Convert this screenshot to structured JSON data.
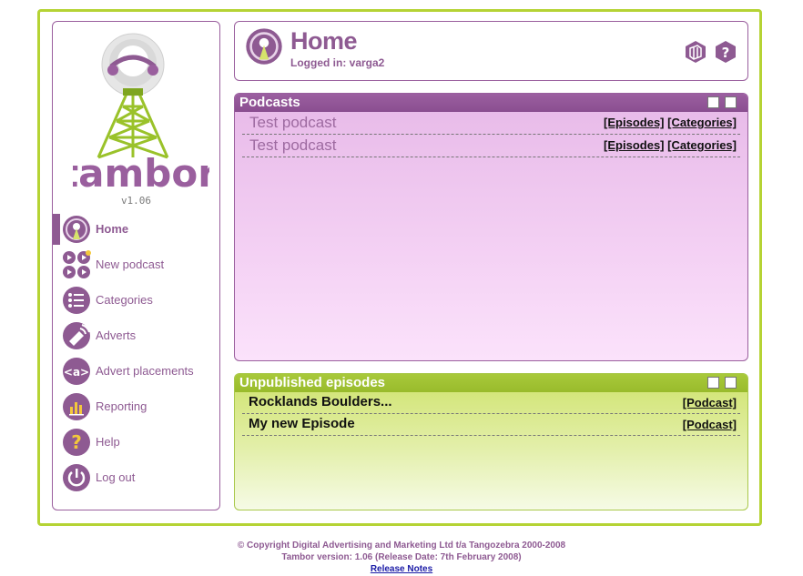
{
  "app": {
    "name": "tambor",
    "version": "v1.06"
  },
  "sidebar": {
    "items": [
      {
        "label": "Home",
        "icon": "broadcast-icon",
        "active": true
      },
      {
        "label": "New podcast",
        "icon": "new-podcast-icon",
        "active": false
      },
      {
        "label": "Categories",
        "icon": "list-icon",
        "active": false
      },
      {
        "label": "Adverts",
        "icon": "megaphone-icon",
        "active": false
      },
      {
        "label": "Advert placements",
        "icon": "tag-icon",
        "active": false
      },
      {
        "label": "Reporting",
        "icon": "bar-chart-icon",
        "active": false
      },
      {
        "label": "Help",
        "icon": "help-icon",
        "active": false
      },
      {
        "label": "Log out",
        "icon": "power-icon",
        "active": false
      }
    ]
  },
  "header": {
    "title": "Home",
    "logged_in": "Logged in: varga2",
    "tools": [
      "hexagon-tool-icon",
      "help-icon"
    ]
  },
  "podcasts": {
    "title": "Podcasts",
    "rows": [
      {
        "name": "Test podcast",
        "link1": "[Episodes]",
        "link2": "[Categories]"
      },
      {
        "name": "Test podcast",
        "link1": "[Episodes]",
        "link2": "[Categories]"
      }
    ]
  },
  "unpublished": {
    "title": "Unpublished episodes",
    "rows": [
      {
        "name": "Rocklands Boulders...",
        "link": "[Podcast]"
      },
      {
        "name": "My new Episode",
        "link": "[Podcast]"
      }
    ]
  },
  "footer": {
    "copyright": "© Copyright Digital Advertising and Marketing Ltd t/a Tangozebra 2000-2008",
    "version_line": "Tambor version: 1.06 (Release Date: 7th February 2008)",
    "release_notes": "Release Notes"
  },
  "colors": {
    "purple": "#8e5a92",
    "green": "#b5d334",
    "pink": "#f4d1f4"
  }
}
